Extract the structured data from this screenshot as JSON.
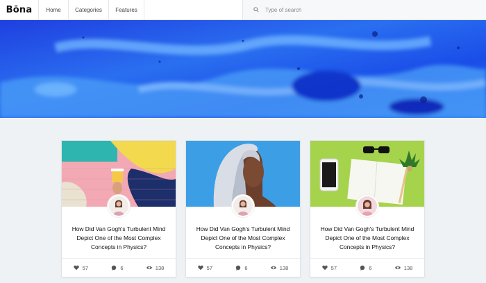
{
  "header": {
    "logo": "Bōna",
    "nav": [
      "Home",
      "Categories",
      "Features"
    ],
    "search_placeholder": "Type of search"
  },
  "cards": [
    {
      "title": "How Did Van Gogh's Turbulent Mind Depict One of the Most Complex Concepts in Physics?",
      "likes": "57",
      "comments": "6",
      "views": "138"
    },
    {
      "title": "How Did Van Gogh's Turbulent Mind Depict One of the Most Complex Concepts in Physics?",
      "likes": "57",
      "comments": "6",
      "views": "138"
    },
    {
      "title": "How Did Van Gogh's Turbulent Mind Depict One of the Most Complex Concepts in Physics?",
      "likes": "57",
      "comments": "6",
      "views": "138"
    }
  ],
  "icons": {
    "search": "search-icon",
    "like": "heart-icon",
    "comment": "comment-icon",
    "view": "eye-icon"
  },
  "colors": {
    "hero": "#1d4fe0",
    "background": "#eef2f5"
  }
}
